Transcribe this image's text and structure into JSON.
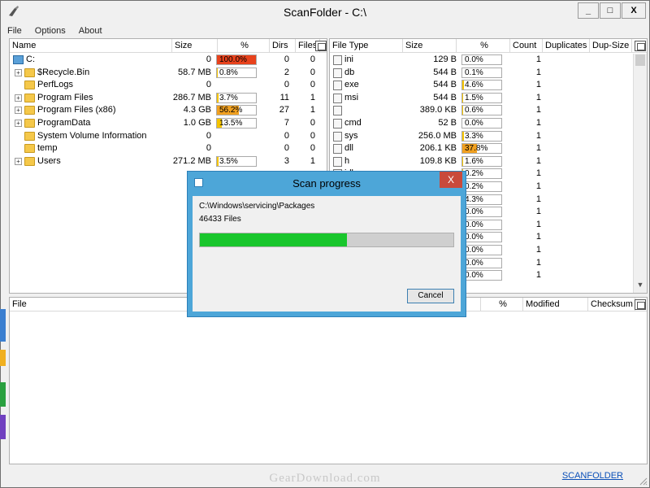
{
  "window": {
    "title": "ScanFolder - C:\\",
    "minimize": "_",
    "maximize": "□",
    "close": "X"
  },
  "menu": [
    "File",
    "Options",
    "About"
  ],
  "folders": {
    "headers": {
      "name": "Name",
      "size": "Size",
      "percent": "%",
      "dirs": "Dirs",
      "files": "Files"
    },
    "rows": [
      {
        "name": "C:",
        "size": "0",
        "percent": "100.0%",
        "fill": 1.0,
        "fill_color": "#e8421c",
        "dirs": "0",
        "files": "0",
        "icon": "drive-icon",
        "expander": false,
        "root": true
      },
      {
        "name": "$Recycle.Bin",
        "size": "58.7 MB",
        "percent": "0.8%",
        "fill": 0.008,
        "fill_color": "#f5c400",
        "dirs": "2",
        "files": "0",
        "icon": "folder-icon",
        "expander": true
      },
      {
        "name": "PerfLogs",
        "size": "0",
        "percent": "",
        "fill": 0,
        "fill_color": "#f5c400",
        "dirs": "0",
        "files": "0",
        "icon": "folder-icon",
        "expander": false
      },
      {
        "name": "Program Files",
        "size": "286.7 MB",
        "percent": "3.7%",
        "fill": 0.037,
        "fill_color": "#f5c400",
        "dirs": "11",
        "files": "1",
        "icon": "folder-icon",
        "expander": true
      },
      {
        "name": "Program Files (x86)",
        "size": "4.3 GB",
        "percent": "56.2%",
        "fill": 0.562,
        "fill_color": "#f0a020",
        "dirs": "27",
        "files": "1",
        "icon": "folder-icon",
        "expander": true
      },
      {
        "name": "ProgramData",
        "size": "1.0 GB",
        "percent": "13.5%",
        "fill": 0.135,
        "fill_color": "#f5c400",
        "dirs": "7",
        "files": "0",
        "icon": "folder-icon",
        "expander": true
      },
      {
        "name": "System Volume Information",
        "size": "0",
        "percent": "",
        "fill": 0,
        "fill_color": "#f5c400",
        "dirs": "0",
        "files": "0",
        "icon": "folder-icon",
        "expander": false
      },
      {
        "name": "temp",
        "size": "0",
        "percent": "",
        "fill": 0,
        "fill_color": "#f5c400",
        "dirs": "0",
        "files": "0",
        "icon": "folder-icon",
        "expander": false
      },
      {
        "name": "Users",
        "size": "271.2 MB",
        "percent": "3.5%",
        "fill": 0.035,
        "fill_color": "#f5c400",
        "dirs": "3",
        "files": "1",
        "icon": "folder-icon",
        "expander": true
      }
    ]
  },
  "filetypes": {
    "headers": {
      "type": "File Type",
      "size": "Size",
      "percent": "%",
      "count": "Count",
      "duplicates": "Duplicates",
      "dupsize": "Dup-Size"
    },
    "rows": [
      {
        "type": "ini",
        "size": "129 B",
        "percent": "0.0%",
        "fill": 0,
        "fill_color": "#f5c400",
        "count": "1"
      },
      {
        "type": "db",
        "size": "544 B",
        "percent": "0.1%",
        "fill": 0.001,
        "fill_color": "#f5c400",
        "count": "1"
      },
      {
        "type": "exe",
        "size": "544 B",
        "percent": "4.6%",
        "fill": 0.046,
        "fill_color": "#f5c400",
        "count": "1"
      },
      {
        "type": "msi",
        "size": "544 B",
        "percent": "1.5%",
        "fill": 0.015,
        "fill_color": "#f5c400",
        "count": "1"
      },
      {
        "type": "",
        "size": "389.0 KB",
        "percent": "0.6%",
        "fill": 0.006,
        "fill_color": "#f5c400",
        "count": "1"
      },
      {
        "type": "cmd",
        "size": "52 B",
        "percent": "0.0%",
        "fill": 0,
        "fill_color": "#f5c400",
        "count": "1"
      },
      {
        "type": "sys",
        "size": "256.0 MB",
        "percent": "3.3%",
        "fill": 0.033,
        "fill_color": "#f5c400",
        "count": "1"
      },
      {
        "type": "dll",
        "size": "206.1 KB",
        "percent": "37.8%",
        "fill": 0.378,
        "fill_color": "#f0a020",
        "count": "1"
      },
      {
        "type": "h",
        "size": "109.8 KB",
        "percent": "1.6%",
        "fill": 0.016,
        "fill_color": "#f5c400",
        "count": "1"
      },
      {
        "type": "idl",
        "size": "",
        "percent": "0.2%",
        "fill": 0.002,
        "fill_color": "#f5c400",
        "count": "1"
      },
      {
        "type": "",
        "size": "",
        "percent": "0.2%",
        "fill": 0.002,
        "fill_color": "#f5c400",
        "count": "1"
      },
      {
        "type": "",
        "size": "",
        "percent": "4.3%",
        "fill": 0.043,
        "fill_color": "#f5c400",
        "count": "1"
      },
      {
        "type": "",
        "size": "",
        "percent": "0.0%",
        "fill": 0,
        "fill_color": "#f5c400",
        "count": "1"
      },
      {
        "type": "",
        "size": "",
        "percent": "0.0%",
        "fill": 0,
        "fill_color": "#f5c400",
        "count": "1"
      },
      {
        "type": "",
        "size": "",
        "percent": "0.0%",
        "fill": 0,
        "fill_color": "#f5c400",
        "count": "1"
      },
      {
        "type": "",
        "size": "",
        "percent": "0.0%",
        "fill": 0,
        "fill_color": "#f5c400",
        "count": "1"
      },
      {
        "type": "",
        "size": "",
        "percent": "0.0%",
        "fill": 0,
        "fill_color": "#f5c400",
        "count": "1"
      },
      {
        "type": "",
        "size": "",
        "percent": "0.0%",
        "fill": 0,
        "fill_color": "#f5c400",
        "count": "1"
      }
    ]
  },
  "files": {
    "headers": {
      "file": "File",
      "percent": "%",
      "modified": "Modified",
      "checksum": "Checksum"
    }
  },
  "dialog": {
    "title": "Scan progress",
    "close": "X",
    "path": "C:\\Windows\\servicing\\Packages",
    "count": "46433 Files",
    "progress": 0.58,
    "progress_color": "#19c62c",
    "cancel": "Cancel"
  },
  "footer": {
    "link": "SCANFOLDER",
    "watermark": "GearDownload.com"
  }
}
